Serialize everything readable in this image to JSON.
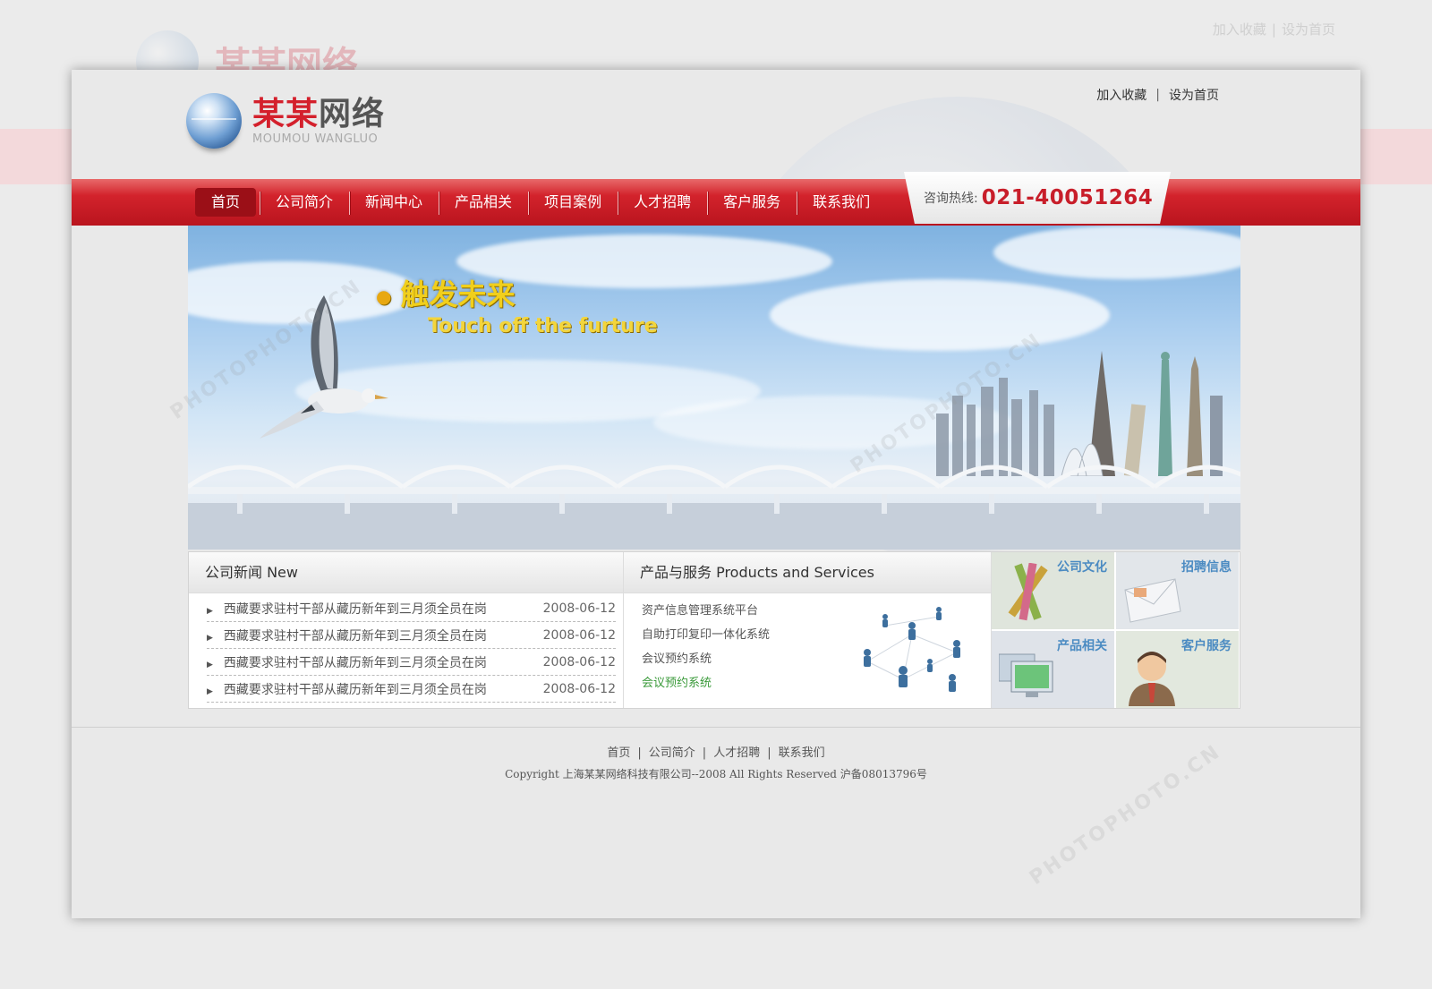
{
  "outer": {
    "top_links": [
      "加入收藏",
      "设为首页"
    ],
    "logo_cn": "某某网络"
  },
  "header": {
    "top_links": [
      {
        "label": "加入收藏"
      },
      {
        "label": "设为首页"
      }
    ],
    "separator": "|",
    "logo": {
      "cn_red": "某某",
      "cn_dark": "网络",
      "en": "MOUMOU WANGLUO"
    }
  },
  "nav": {
    "items": [
      {
        "label": "首页",
        "active": true
      },
      {
        "label": "公司简介"
      },
      {
        "label": "新闻中心"
      },
      {
        "label": "产品相关"
      },
      {
        "label": "项目案例"
      },
      {
        "label": "人才招聘"
      },
      {
        "label": "客户服务"
      },
      {
        "label": "联系我们"
      }
    ],
    "hotline_label": "咨询热线:",
    "hotline_number": "021-40051264"
  },
  "banner": {
    "title_cn": "触发未来",
    "title_en": "Touch off the furture"
  },
  "news": {
    "heading": "公司新闻 New",
    "items": [
      {
        "title": "西藏要求驻村干部从藏历新年到三月须全员在岗",
        "date": "2008-06-12"
      },
      {
        "title": "西藏要求驻村干部从藏历新年到三月须全员在岗",
        "date": "2008-06-12"
      },
      {
        "title": "西藏要求驻村干部从藏历新年到三月须全员在岗",
        "date": "2008-06-12"
      },
      {
        "title": "西藏要求驻村干部从藏历新年到三月须全员在岗",
        "date": "2008-06-12"
      }
    ]
  },
  "products": {
    "heading": "产品与服务 Products and Services",
    "items": [
      {
        "label": "资产信息管理系统平台"
      },
      {
        "label": "自助打印复印一体化系统"
      },
      {
        "label": "会议预约系统"
      },
      {
        "label": "会议预约系统",
        "highlight": true
      }
    ]
  },
  "tiles": [
    {
      "title": "公司文化",
      "icon": "pencils-icon"
    },
    {
      "title": "招聘信息",
      "icon": "envelope-icon"
    },
    {
      "title": "产品相关",
      "icon": "monitors-icon"
    },
    {
      "title": "客户服务",
      "icon": "support-person-icon"
    }
  ],
  "footer": {
    "links": [
      "首页",
      "公司简介",
      "人才招聘",
      "联系我们"
    ],
    "separator": "|",
    "copyright": "Copyright 上海某某网络科技有限公司--2008 All Rights Reserved 沪备08013796号"
  },
  "colors": {
    "brand_red": "#d4202c",
    "nav_dark": "#9b0f17",
    "tile_title": "#4b8bc2",
    "highlight_green": "#3a9a3a"
  }
}
